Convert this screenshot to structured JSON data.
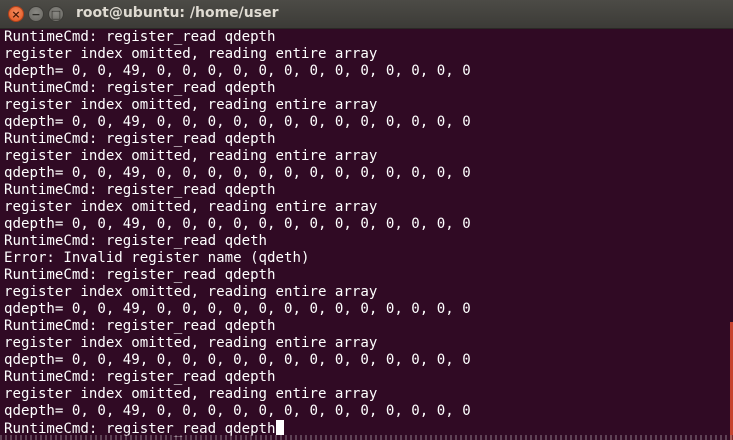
{
  "window": {
    "title": "root@ubuntu: /home/user",
    "close_glyph": "×",
    "minimize_glyph": "−",
    "maximize_glyph": "□"
  },
  "terminal": {
    "lines": [
      "RuntimeCmd: register_read qdepth",
      "register index omitted, reading entire array",
      "qdepth= 0, 0, 49, 0, 0, 0, 0, 0, 0, 0, 0, 0, 0, 0, 0, 0",
      "RuntimeCmd: register_read qdepth",
      "register index omitted, reading entire array",
      "qdepth= 0, 0, 49, 0, 0, 0, 0, 0, 0, 0, 0, 0, 0, 0, 0, 0",
      "RuntimeCmd: register_read qdepth",
      "register index omitted, reading entire array",
      "qdepth= 0, 0, 49, 0, 0, 0, 0, 0, 0, 0, 0, 0, 0, 0, 0, 0",
      "RuntimeCmd: register_read qdepth",
      "register index omitted, reading entire array",
      "qdepth= 0, 0, 49, 0, 0, 0, 0, 0, 0, 0, 0, 0, 0, 0, 0, 0",
      "RuntimeCmd: register_read qdeth",
      "Error: Invalid register name (qdeth)",
      "RuntimeCmd: register_read qdepth",
      "register index omitted, reading entire array",
      "qdepth= 0, 0, 49, 0, 0, 0, 0, 0, 0, 0, 0, 0, 0, 0, 0, 0",
      "RuntimeCmd: register_read qdepth",
      "register index omitted, reading entire array",
      "qdepth= 0, 0, 49, 0, 0, 0, 0, 0, 0, 0, 0, 0, 0, 0, 0, 0",
      "RuntimeCmd: register_read qdepth",
      "register index omitted, reading entire array",
      "qdepth= 0, 0, 49, 0, 0, 0, 0, 0, 0, 0, 0, 0, 0, 0, 0, 0"
    ],
    "prompt_line": "RuntimeCmd: register_read qdepth",
    "colors": {
      "background": "#300a24",
      "foreground": "#ffffff",
      "titlebar": "#3c3b37",
      "title_text": "#dfdbd2",
      "close_button": "#e95420",
      "scroll_indicator": "#c7432e"
    }
  }
}
